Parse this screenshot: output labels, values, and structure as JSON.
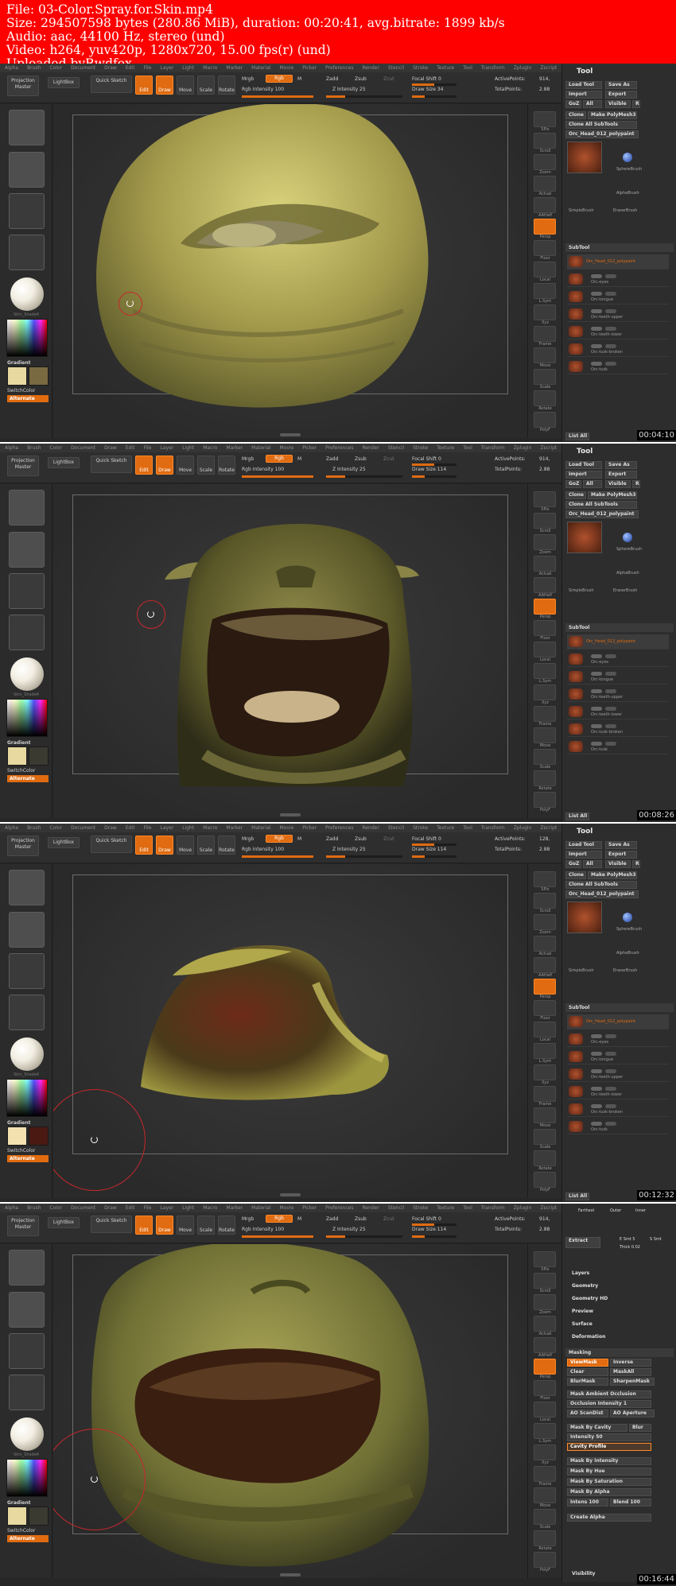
{
  "header": {
    "line1": "File: 03-Color.Spray.for.Skin.mp4",
    "line2": "Size: 294507598 bytes (280.86 MiB), duration: 00:20:41, avg.bitrate: 1899 kb/s",
    "line3": "Audio: aac, 44100 Hz, stereo (und)",
    "line4": "Video: h264, yuv420p, 1280x720, 15.00 fps(r) (und)",
    "line5": "Uploaded byRwdfox"
  },
  "zbrush": {
    "menus": [
      "Alpha",
      "Brush",
      "Color",
      "Document",
      "Draw",
      "Edit",
      "File",
      "Layer",
      "Light",
      "Macro",
      "Marker",
      "Material",
      "Movie",
      "Picker",
      "Preferences",
      "Render",
      "Stencil",
      "Stroke",
      "Texture",
      "Tool",
      "Transform",
      "Zplugin",
      "Zscript"
    ],
    "projection_master": "Projection Master",
    "lightbox": "LightBox",
    "quick_sketch": "Quick Sketch",
    "edit": "Edit",
    "draw": "Draw",
    "move": "Move",
    "scale": "Scale",
    "rotate": "Rotate",
    "mrgb": "Mrgb",
    "rgb": "Rgb",
    "m": "M",
    "rgb_intensity": "Rgb Intensity 100",
    "zadd": "Zadd",
    "zsub": "Zsub",
    "zcut": "Zcut",
    "z_intensity": "Z Intensity 25",
    "focal_shift": "Focal Shift 0",
    "active_points": "ActivePoints:",
    "total_points": "TotalPoints:",
    "material_label": "Skin_Shade4",
    "alternate": "Alternate",
    "gradient": "Gradient",
    "switchcolor": "SwitchColor",
    "right_shelf": [
      "SPix",
      "Scroll",
      "Zoom",
      "Actual",
      "AAHalf",
      "Persp",
      "Floor",
      "Local",
      "L.Sym",
      "Xyz",
      "Frame",
      "Move",
      "Scale",
      "Rotate",
      "PolyF"
    ]
  },
  "tool": {
    "title": "Tool",
    "load_tool": "Load Tool",
    "save_as": "Save As",
    "import": "Import",
    "export": "Export",
    "goz": "GoZ",
    "all": "All",
    "visible": "Visible",
    "r": "R",
    "clone": "Clone",
    "make_polymesh": "Make PolyMesh3D",
    "clone_all_subtools": "Clone All SubTools",
    "orc_head": "Orc_Head_012_polypaint",
    "sphere_brush": "SphereBrush",
    "alpha_brush": "AlphaBrush",
    "simple_brush": "SimpleBrush",
    "eraser_brush": "EraserBrush",
    "subtool": "SubTool",
    "subtools": [
      "Orc_Head_012_polypaint",
      "Orc-eyes",
      "Orc-tongue",
      "Orc-teeth-upper",
      "Orc-teeth-lower",
      "Orc-tusk-broken",
      "Orc-tusk"
    ],
    "list_all": "List All"
  },
  "frames": [
    {
      "time": "00:04:10",
      "active_points": "914,",
      "total_points": "2.88",
      "draw_size": "Draw Size 34"
    },
    {
      "time": "00:08:26",
      "active_points": "914,",
      "total_points": "2.88",
      "draw_size": "Draw Size 114"
    },
    {
      "time": "00:12:32",
      "active_points": "128,",
      "total_points": "2.88",
      "draw_size": "Draw Size 114"
    },
    {
      "time": "00:16:44",
      "active_points": "914,",
      "total_points": "2.88",
      "draw_size": "Draw Size 114"
    }
  ],
  "masking_panel": {
    "farthest": "Farthest",
    "outer": "Outer",
    "inner": "Inner",
    "extract": "Extract",
    "e_smt": "E Smt 5",
    "s_smt": "S Smt",
    "thick": "Thick 0.02",
    "sections": [
      "Layers",
      "Geometry",
      "Geometry HD",
      "Preview",
      "Surface",
      "Deformation"
    ],
    "masking": "Masking",
    "view_mask": "ViewMask",
    "inverse": "Inverse",
    "clear": "Clear",
    "mask_all": "MaskAll",
    "blur_mask": "BlurMask",
    "sharpen_mask": "SharpenMask",
    "mask_ambient": "Mask Ambient Occlusion",
    "occlusion_intensity": "Occlusion Intensity 1",
    "ao_scandist": "AO ScanDist",
    "ao_aperture": "AO Aperture",
    "mask_by_cavity": "Mask By Cavity",
    "blur": "Blur",
    "intensity": "Intensity 50",
    "cavity_profile": "Cavity Profile",
    "mask_by_intensity": "Mask By Intensity",
    "mask_by_hue": "Mask By Hue",
    "mask_by_saturation": "Mask By Saturation",
    "mask_by_alpha": "Mask By Alpha",
    "intens": "Intens 100",
    "blend": "Blend 100",
    "create_alpha": "Create Alpha",
    "visibility": "Visibility"
  },
  "colors": {
    "banner": "#ff0000",
    "accent_orange": "#e06b10",
    "ui_dark": "#2d2d2d",
    "brush_ring": "#c8272d"
  }
}
